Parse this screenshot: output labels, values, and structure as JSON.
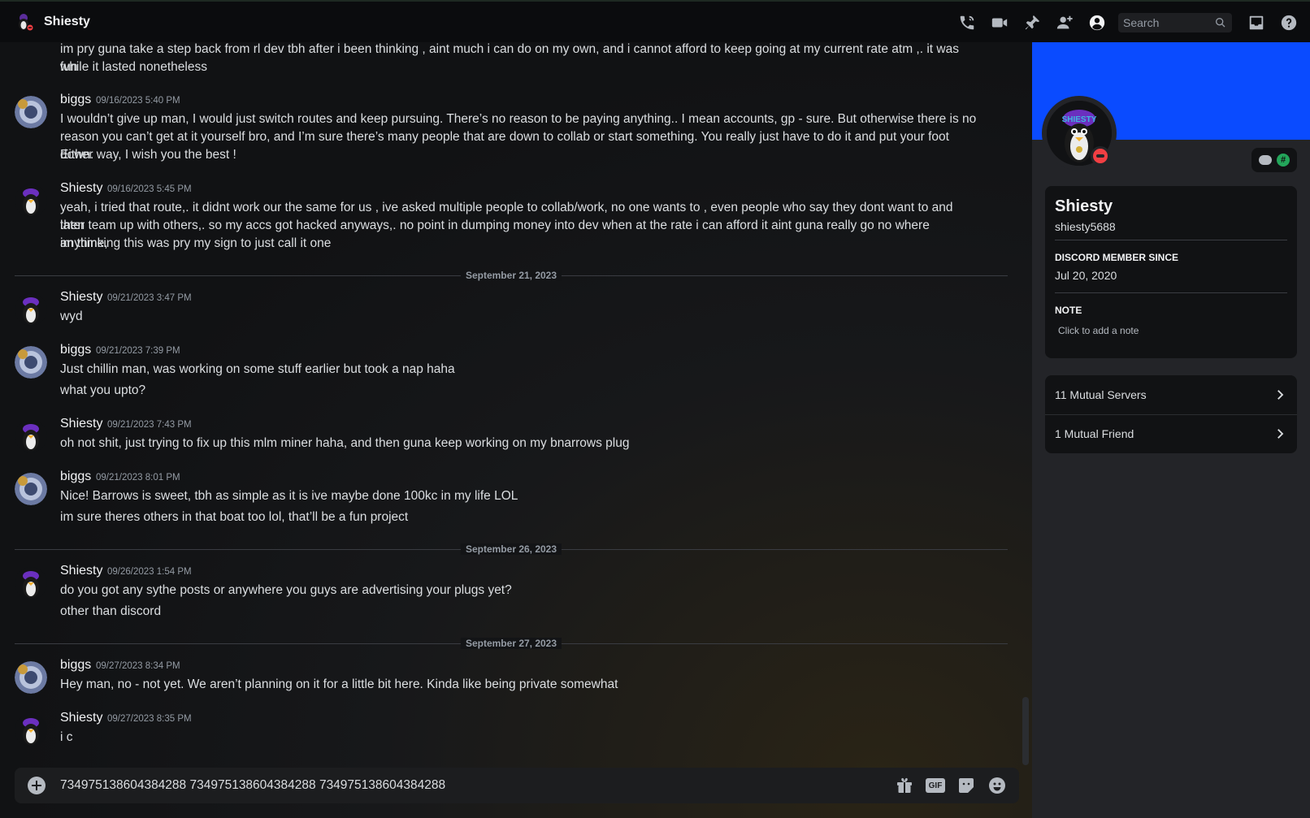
{
  "header": {
    "title": "Shiesty",
    "search_placeholder": "Search",
    "icons": [
      "call-icon",
      "video-icon",
      "pin-icon",
      "add-friend-icon",
      "profile-toggle-icon",
      "inbox-icon",
      "help-icon"
    ]
  },
  "messages": [
    {
      "lines": [
        "im pry guna take a step back from rl dev tbh after i been thinking ,  aint much i can do on my own, and i cannot afford to keep going at my current rate atm ,.  it was fun",
        "while it lasted nonetheless"
      ]
    },
    {
      "author": "biggs",
      "time": "09/16/2023 5:40 PM",
      "lines": [
        "I wouldn’t give up man, I would just switch routes and keep pursuing. There’s no reason to be paying anything.. I mean accounts, gp - sure. But otherwise there is no",
        "reason you can’t get at it yourself bro, and I’m sure there’s many people that are down to collab or start something. You really just have to do it and put your foot down.",
        "Either way, I wish you the best !"
      ]
    },
    {
      "author": "Shiesty",
      "time": "09/16/2023 5:45 PM",
      "lines": [
        "yeah, i tried that route,. it didnt work our the same for us , ive asked multiple people to collab/work, no one wants to , even people who say they dont want to and then",
        "later team up with others,. so my accs got hacked anyways,. no point in dumping money into dev when at the rate i can afford it aint guna really go no where anytime,",
        "im thinking this was pry my sign to just call it one"
      ]
    },
    {
      "author": "Shiesty",
      "time": "09/21/2023 3:47 PM",
      "lines": [
        "wyd"
      ]
    },
    {
      "author": "biggs",
      "time": "09/21/2023 7:39 PM",
      "lines": [
        "Just chillin man, was working on some stuff earlier but took a nap haha",
        "what you upto?"
      ]
    },
    {
      "author": "Shiesty",
      "time": "09/21/2023 7:43 PM",
      "lines": [
        "oh not shit, just trying to fix up this mlm miner haha, and then guna keep working on my bnarrows plug"
      ]
    },
    {
      "author": "biggs",
      "time": "09/21/2023 8:01 PM",
      "lines": [
        "Nice! Barrows is sweet, tbh as simple as it is ive maybe done 100kc in my life LOL",
        "im sure theres others in that boat too lol, that’ll be a fun project"
      ]
    },
    {
      "author": "Shiesty",
      "time": "09/26/2023 1:54 PM",
      "lines": [
        "do you got any sythe posts or anywhere you guys are advertising your plugs yet?",
        "other than discord"
      ]
    },
    {
      "author": "biggs",
      "time": "09/27/2023 8:34 PM",
      "lines": [
        "Hey man, no - not yet. We aren’t planning on it for a little bit here. Kinda like being private somewhat"
      ]
    },
    {
      "author": "Shiesty",
      "time": "09/27/2023 8:35 PM",
      "lines": [
        "i c"
      ]
    }
  ],
  "dividers": [
    "September 21, 2023",
    "September 26, 2023",
    "September 27, 2023"
  ],
  "composer": {
    "text": "734975138604384288 734975138604384288 734975138604384288",
    "gif_label": "GIF",
    "icons": [
      "add-attachment-icon",
      "gift-icon",
      "gif-icon",
      "sticker-icon",
      "emoji-icon"
    ]
  },
  "profile": {
    "display_name": "Shiesty",
    "username": "shiesty5688",
    "banner_color": "#0a4bff",
    "status": "do-not-disturb",
    "member_since_label": "DISCORD MEMBER SINCE",
    "member_since": "Jul 20, 2020",
    "note_label": "NOTE",
    "note_placeholder": "Click to add a note",
    "mutual_servers": "11 Mutual Servers",
    "mutual_friends": "1 Mutual Friend",
    "badge_hash": "#"
  },
  "colors": {
    "dnd_red": "#f23f43",
    "badge_green": "#23a55a"
  }
}
